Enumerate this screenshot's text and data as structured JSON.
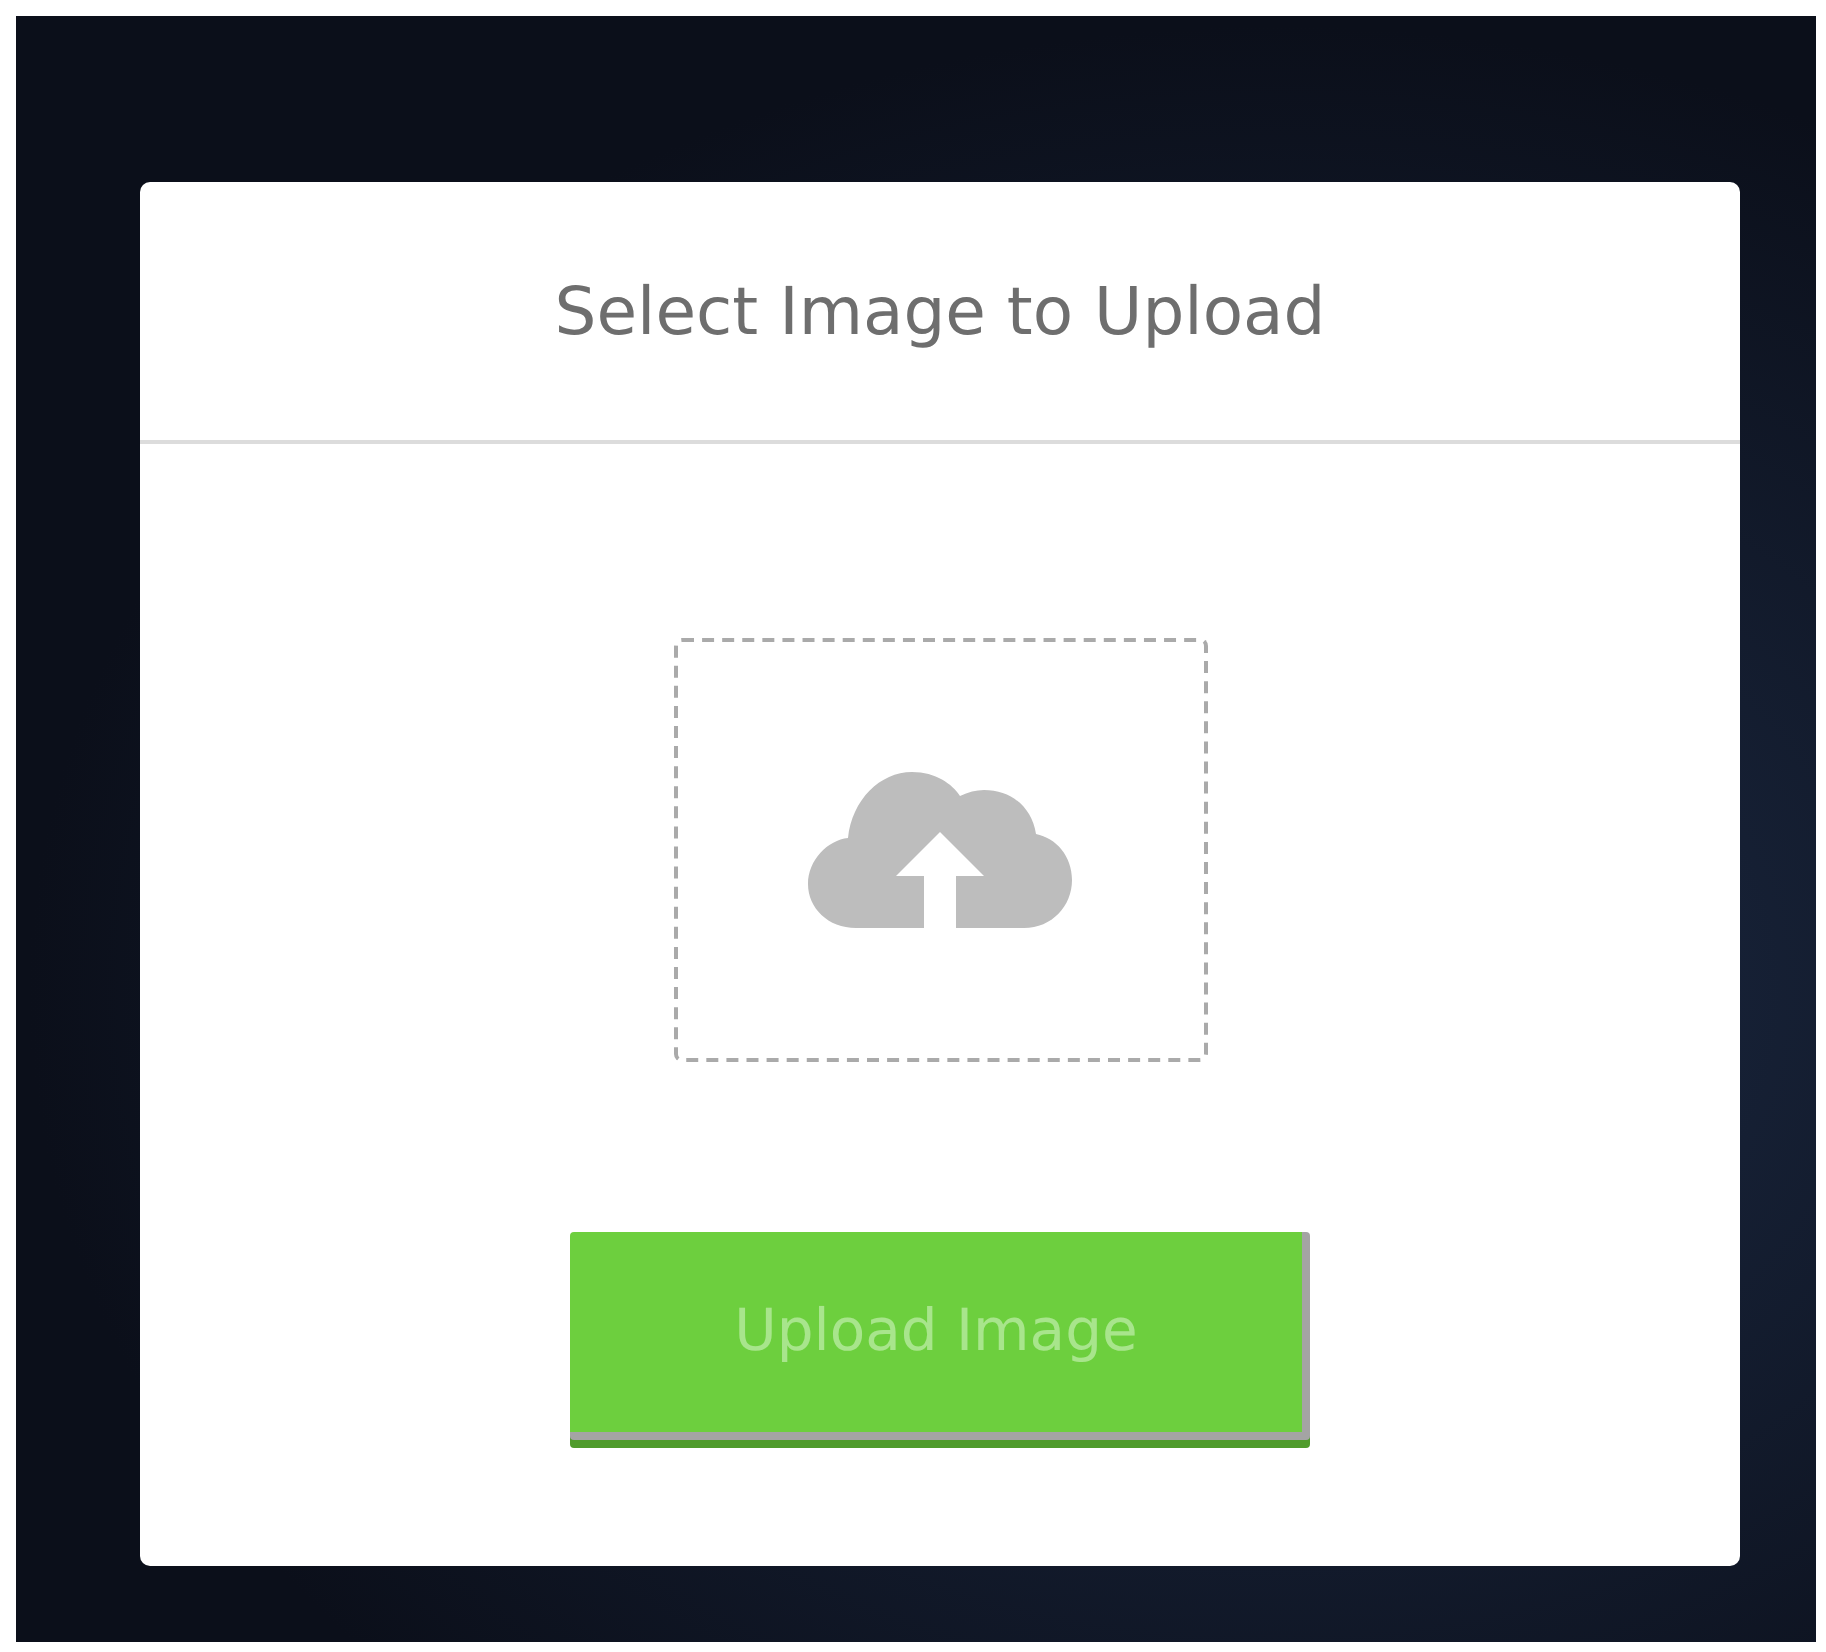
{
  "dialog": {
    "title": "Select Image to Upload",
    "button": "Upload Image"
  }
}
